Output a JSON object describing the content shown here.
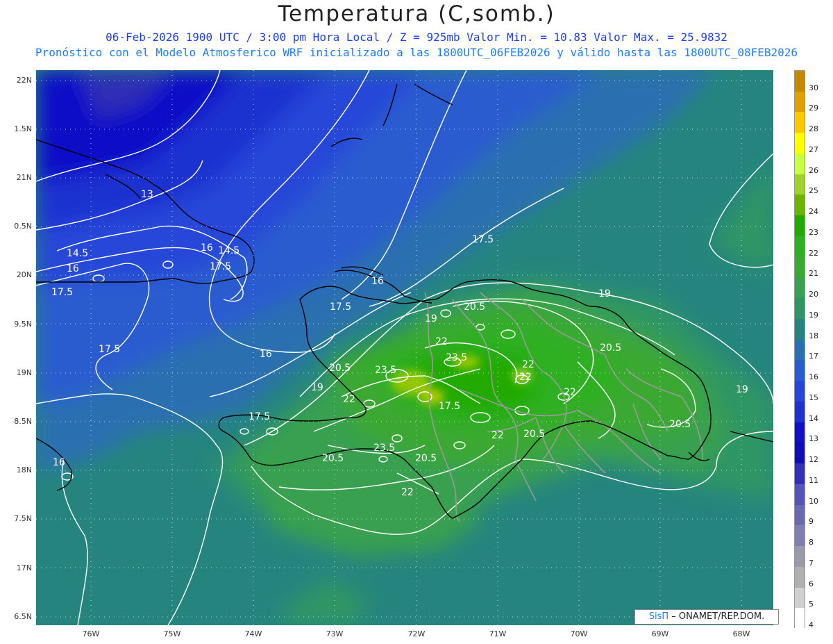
{
  "header": {
    "title": "Temperatura (C,somb.)",
    "line1": "06-Feb-2026  1900 UTC / 3:00 pm Hora Local / Z = 925mb     Valor Min. = 10.83  Valor Max. = 25.9832",
    "line2": "Pronóstico con el Modelo Atmosferico WRF inicializado a las 1800UTC_06FEB2026 y válido hasta las  1800UTC_08FEB2026"
  },
  "axes": {
    "lat_labels": [
      "22N",
      "1.5N",
      "21N",
      "0.5N",
      "20N",
      "9.5N",
      "19N",
      "8.5N",
      "18N",
      "7.5N",
      "17N",
      "6.5N"
    ],
    "lon_labels": [
      "76W",
      "75W",
      "74W",
      "73W",
      "72W",
      "71W",
      "70W",
      "69W",
      "68W"
    ]
  },
  "colorbar": {
    "labels": [
      "30",
      "29",
      "28",
      "27",
      "26",
      "25",
      "24",
      "23",
      "22",
      "21",
      "20",
      "19",
      "18",
      "17",
      "16",
      "15",
      "14",
      "13",
      "12",
      "11",
      "10",
      "9",
      "8",
      "7",
      "6",
      "5",
      "4"
    ],
    "colors": [
      "#c28a00",
      "#e0a000",
      "#ffc800",
      "#ffff00",
      "#c8ff40",
      "#9fd22a",
      "#6cb400",
      "#22aa00",
      "#2db020",
      "#3aa833",
      "#38a050",
      "#2f9565",
      "#25857e",
      "#2a6fb0",
      "#2a5cd0",
      "#2546d8",
      "#1e30d0",
      "#1010c8",
      "#0d0db8",
      "#3030b8",
      "#5555b8",
      "#6a6ab0",
      "#8080b0",
      "#9a9aaa",
      "#b0b0b0",
      "#d0d0d0",
      "#ffffff"
    ]
  },
  "contour_labels": [
    "13",
    "14.5",
    "16",
    "16",
    "14.5",
    "17.5",
    "16",
    "17.5",
    "17.5",
    "17.5",
    "17.5",
    "16",
    "16",
    "17.5",
    "19",
    "19",
    "19",
    "19",
    "20.5",
    "20.5",
    "20.5",
    "20.5",
    "20.5",
    "20.5",
    "20.5",
    "22",
    "22",
    "22",
    "22",
    "22",
    "22",
    "22",
    "23.5",
    "23.5",
    "23.5",
    "17.5"
  ],
  "credit": {
    "brand": "SisΠ",
    "text": " – ONAMET/REP.DOM."
  },
  "colors": {
    "title": "#222222",
    "subtitle": "#1a3cff",
    "contour": "#ffffff",
    "coast": "#000000",
    "borders": "#9a9a9a"
  }
}
